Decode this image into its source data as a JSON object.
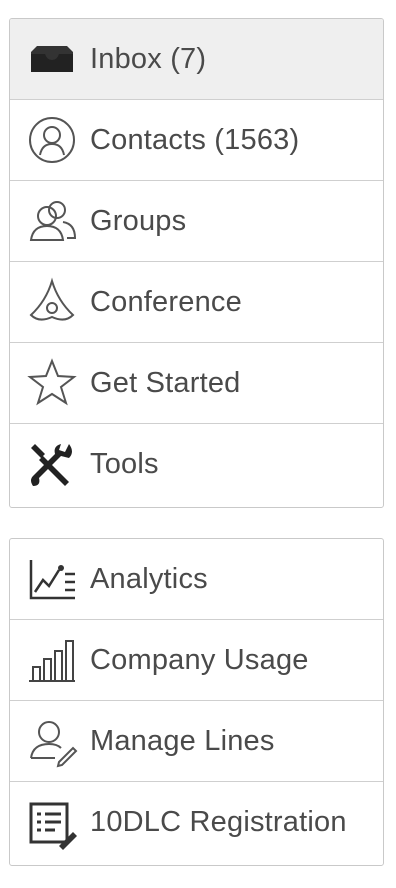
{
  "colors": {
    "text": "#4a4a4a",
    "active_bg": "#efefef",
    "border": "#c9c9c9"
  },
  "menu_primary": [
    {
      "label": "Inbox (7)",
      "icon": "inbox-icon",
      "active": true
    },
    {
      "label": "Contacts (1563)",
      "icon": "contact-icon"
    },
    {
      "label": "Groups",
      "icon": "groups-icon"
    },
    {
      "label": "Conference",
      "icon": "conference-icon"
    },
    {
      "label": "Get Started",
      "icon": "star-icon"
    },
    {
      "label": "Tools",
      "icon": "tools-icon"
    }
  ],
  "menu_secondary": [
    {
      "label": "Analytics",
      "icon": "analytics-icon"
    },
    {
      "label": "Company Usage",
      "icon": "bar-chart-icon"
    },
    {
      "label": "Manage Lines",
      "icon": "user-edit-icon"
    },
    {
      "label": "10DLC Registration",
      "icon": "registration-icon"
    }
  ]
}
